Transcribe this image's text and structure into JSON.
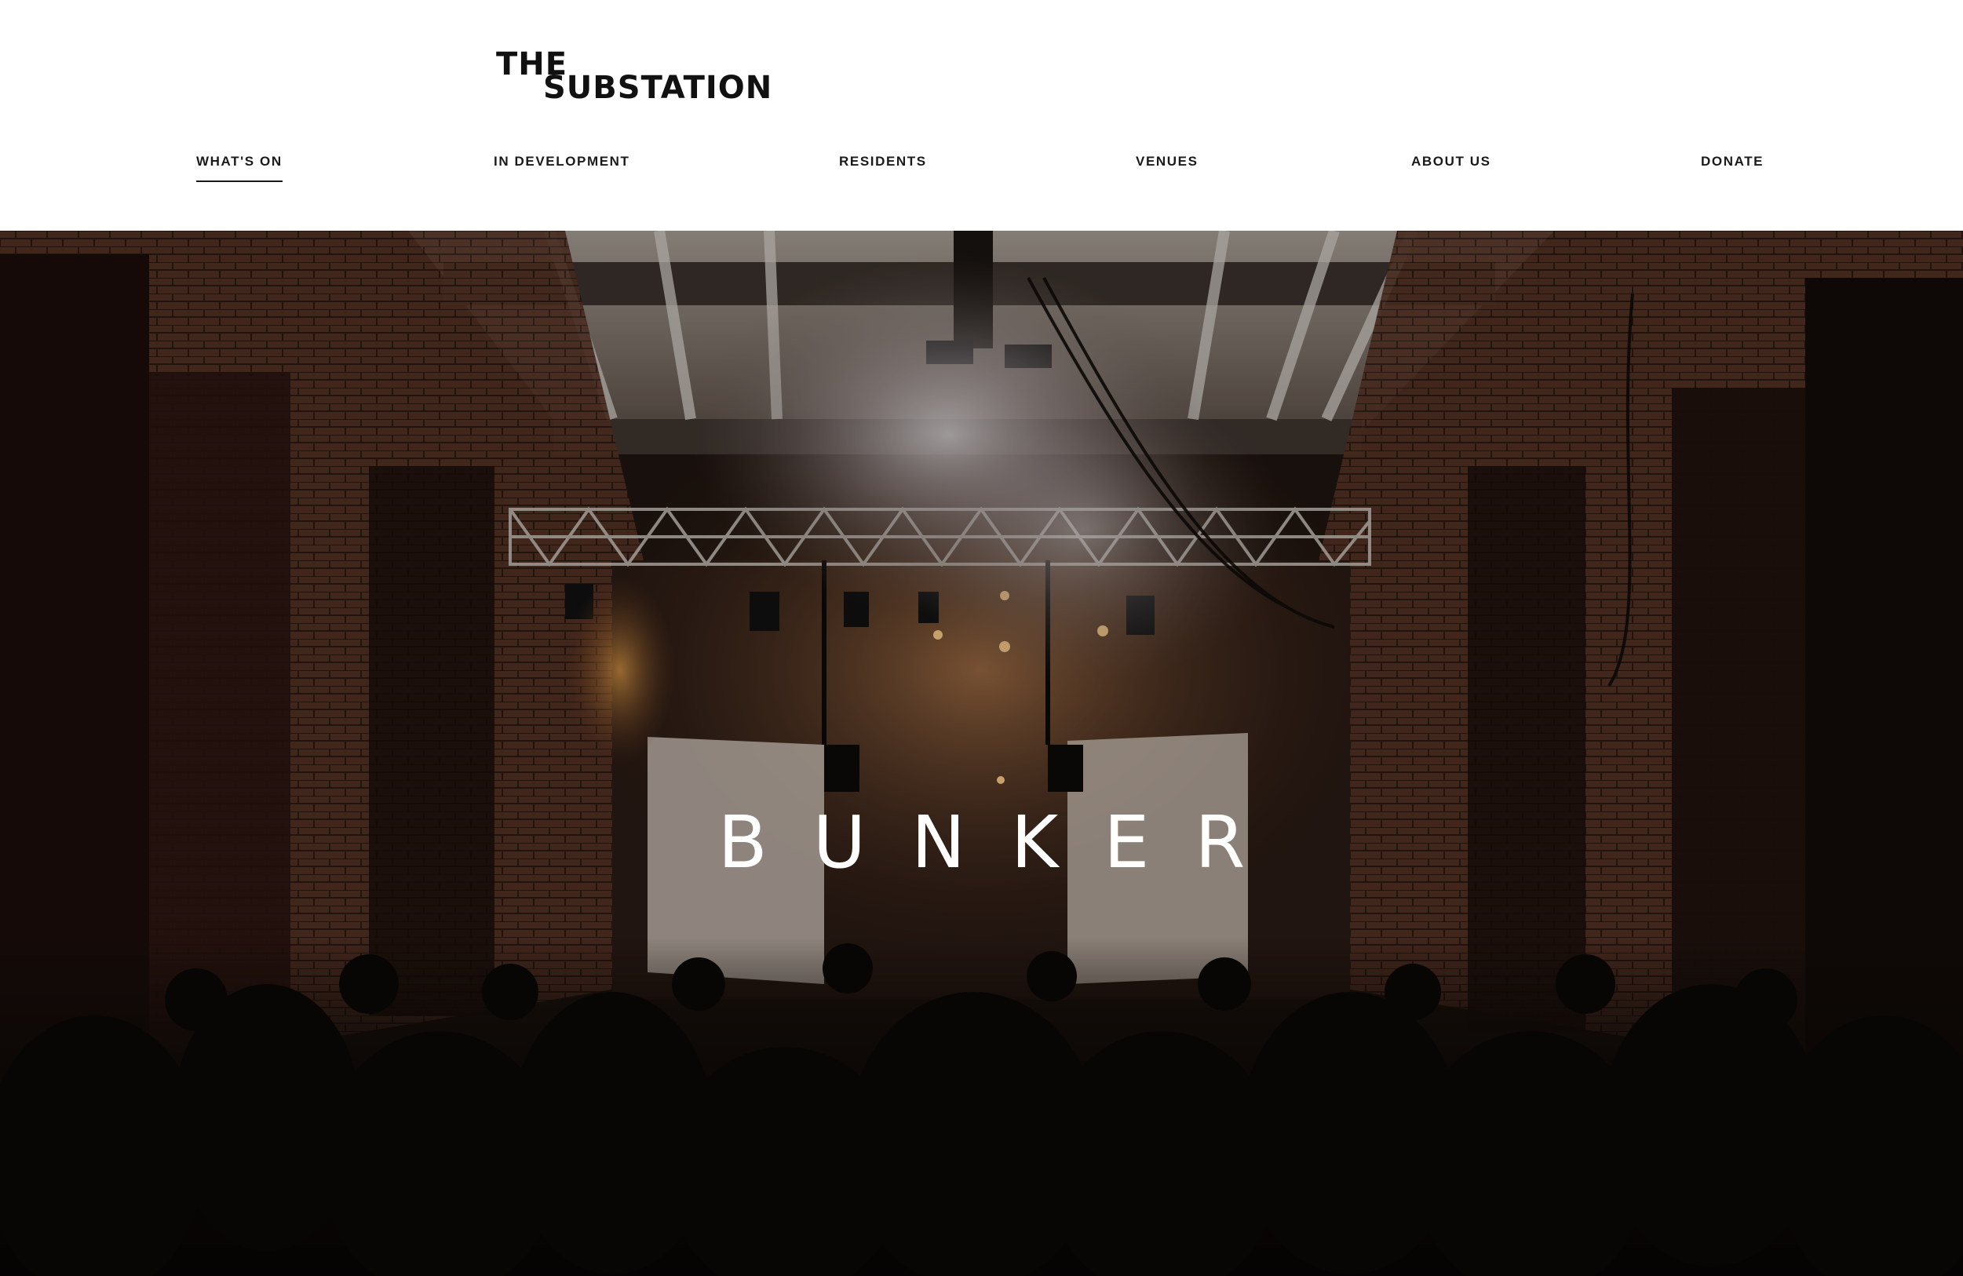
{
  "brand": {
    "logo_line1": "THE",
    "logo_line2": "SUBSTATION"
  },
  "nav": {
    "items": [
      {
        "label": "WHAT'S ON",
        "active": true
      },
      {
        "label": "IN DEVELOPMENT",
        "active": false
      },
      {
        "label": "RESIDENTS",
        "active": false
      },
      {
        "label": "VENUES",
        "active": false
      },
      {
        "label": "ABOUT US",
        "active": false
      },
      {
        "label": "DONATE",
        "active": false
      }
    ]
  },
  "hero": {
    "title": "BUNKER"
  },
  "colors": {
    "text": "#1a1a1a",
    "background": "#ffffff",
    "hero_text": "#ffffff"
  }
}
